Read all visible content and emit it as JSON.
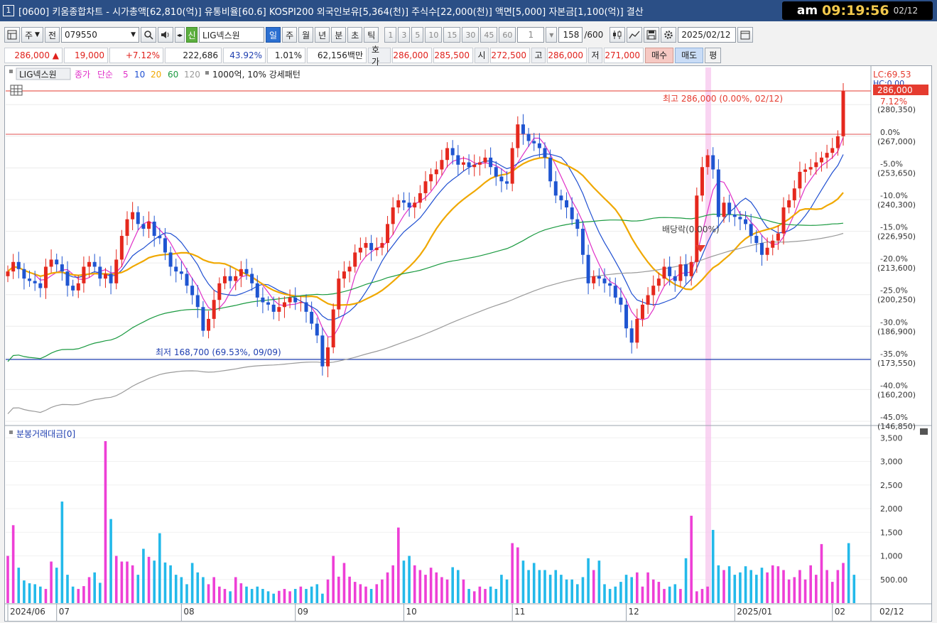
{
  "window": {
    "number": "1",
    "title": "[0600] 키움종합차트 - 시가총액[62,810(억)] 유통비율[60.6] KOSPI200 외국인보유[5,364(천)] 주식수[22,000(천)] 액면[5,000] 자본금[1,100(억)] 결산"
  },
  "clock": {
    "ampm": "am",
    "time": "09:19:56",
    "date": "02/12"
  },
  "toolbar": {
    "market": "주",
    "mode": "전",
    "code": "079550",
    "badge": "신",
    "stock_name": "LIG넥스원",
    "periods": [
      "일",
      "주",
      "월",
      "년",
      "분",
      "초",
      "틱"
    ],
    "active_period": "일",
    "minute_options": [
      "1",
      "3",
      "5",
      "10",
      "15",
      "30",
      "45",
      "60"
    ],
    "interval": "1",
    "count": "158",
    "count_max": "/600",
    "date": "2025/02/12"
  },
  "quote": {
    "price": "286,000 ▲",
    "change": "19,000",
    "change_rate": "+7.12%",
    "volume": "222,686",
    "vol_ratio": "43.92%",
    "turnover": "1.01%",
    "amount": "62,156백만",
    "hoga_label": "호가",
    "ask": "286,000",
    "bid": "285,500",
    "open_label": "시",
    "open": "272,500",
    "high_label": "고",
    "high": "286,000",
    "low_label": "저",
    "low": "271,000",
    "buy_label": "매수",
    "sell_label": "매도",
    "eval_label": "평"
  },
  "legend": {
    "name": "LIG넥스원",
    "close": "종가",
    "simple": "단순",
    "ma_labels": [
      "5",
      "10",
      "20",
      "60",
      "120"
    ],
    "ma_colors": [
      "#e030c8",
      "#1f4fd1",
      "#f0a800",
      "#1a9a40",
      "#9a9a9a"
    ],
    "extra": "1000억, 10% 강세패턴"
  },
  "annotations": {
    "high_text": "최고 286,000 (0.00%, 02/12)",
    "low_text": "최저 168,700 (69.53%, 09/09)",
    "dividend_text": "배당락(0.00%)",
    "lc_label": "LC:69.53",
    "hc_label": "HC:0.00",
    "price_tag": "286,000",
    "price_change_tag": "7.12%"
  },
  "volume_pane": {
    "title": "분봉거래대금[0]"
  },
  "axis": {
    "price_ticks": [
      {
        "pct": "",
        "price": "(280,350)"
      },
      {
        "pct": "0.0%",
        "price": "(267,000)"
      },
      {
        "pct": "-5.0%",
        "price": "(253,650)"
      },
      {
        "pct": "-10.0%",
        "price": "(240,300)"
      },
      {
        "pct": "-15.0%",
        "price": "(226,950)"
      },
      {
        "pct": "-20.0%",
        "price": "(213,600)"
      },
      {
        "pct": "-25.0%",
        "price": "(200,250)"
      },
      {
        "pct": "-30.0%",
        "price": "(186,900)"
      },
      {
        "pct": "-35.0%",
        "price": "(173,550)"
      },
      {
        "pct": "-40.0%",
        "price": "(160,200)"
      },
      {
        "pct": "-45.0%",
        "price": "(146,850)"
      }
    ],
    "volume_ticks": [
      "3,500",
      "3,000",
      "2,500",
      "2,000",
      "1,500",
      "1,000",
      "500.00"
    ],
    "date_labels": [
      "2024/06",
      "07",
      "08",
      "09",
      "10",
      "11",
      "12",
      "2025/01",
      "02",
      "02/12"
    ]
  },
  "chart_data": {
    "type": "candlestick",
    "series_price": [
      {
        "name": "종가"
      },
      {
        "name": "5"
      },
      {
        "name": "10"
      },
      {
        "name": "20"
      },
      {
        "name": "60"
      },
      {
        "name": "120"
      }
    ],
    "ylim_price": [
      146850,
      290000
    ],
    "ylim_volume": [
      0,
      3700
    ],
    "volume_unit": "억",
    "closes": [
      210000,
      214000,
      211000,
      207000,
      206000,
      205000,
      203000,
      212000,
      215000,
      213000,
      210000,
      204000,
      202000,
      205000,
      212000,
      214000,
      212000,
      207000,
      209000,
      205000,
      215000,
      225000,
      232000,
      235000,
      230000,
      228000,
      231000,
      225000,
      224000,
      218000,
      212000,
      210000,
      209000,
      204000,
      200000,
      195000,
      185000,
      190000,
      198000,
      205000,
      208000,
      206000,
      208000,
      211000,
      209000,
      205000,
      199000,
      197000,
      196000,
      193000,
      195000,
      197000,
      199000,
      197000,
      197000,
      193000,
      188000,
      183000,
      170000,
      178000,
      194000,
      207000,
      210000,
      212000,
      218000,
      220000,
      222000,
      219000,
      220000,
      222000,
      230000,
      237000,
      240000,
      239000,
      237000,
      239000,
      243000,
      248000,
      251000,
      253000,
      257000,
      262000,
      259000,
      255000,
      256000,
      254000,
      255000,
      256000,
      258000,
      254000,
      250000,
      248000,
      247000,
      262000,
      272000,
      268000,
      265000,
      264000,
      262000,
      258000,
      248000,
      242000,
      240000,
      237000,
      232000,
      228000,
      217000,
      205000,
      208000,
      207000,
      205000,
      204000,
      199000,
      196000,
      186000,
      180000,
      190000,
      196000,
      200000,
      204000,
      207000,
      212000,
      208000,
      206000,
      213000,
      208000,
      214000,
      242000,
      254000,
      259000,
      253000,
      233000,
      239000,
      234000,
      233000,
      232000,
      230000,
      225000,
      222000,
      217000,
      220000,
      223000,
      226000,
      237000,
      240000,
      245000,
      252000,
      253000,
      254000,
      256000,
      258000,
      260000,
      262000,
      267000,
      286000
    ],
    "volumes": [
      1000,
      1650,
      750,
      480,
      420,
      400,
      350,
      300,
      880,
      750,
      2150,
      600,
      350,
      300,
      360,
      550,
      650,
      430,
      3430,
      1780,
      1000,
      880,
      880,
      800,
      600,
      1150,
      980,
      900,
      1480,
      860,
      800,
      600,
      550,
      400,
      850,
      650,
      550,
      400,
      550,
      350,
      300,
      250,
      550,
      420,
      350,
      300,
      350,
      300,
      250,
      200,
      260,
      300,
      250,
      300,
      350,
      300,
      350,
      400,
      200,
      500,
      1000,
      560,
      850,
      560,
      450,
      400,
      350,
      300,
      400,
      500,
      650,
      800,
      1600,
      900,
      1000,
      800,
      700,
      600,
      750,
      650,
      550,
      500,
      760,
      700,
      500,
      300,
      250,
      350,
      300,
      350,
      300,
      600,
      500,
      1270,
      1180,
      900,
      700,
      850,
      700,
      700,
      600,
      700,
      600,
      500,
      500,
      400,
      550,
      950,
      700,
      900,
      400,
      300,
      350,
      450,
      600,
      550,
      650,
      350,
      650,
      500,
      450,
      300,
      350,
      400,
      300,
      950,
      1850,
      250,
      300,
      350,
      1550,
      800,
      700,
      780,
      600,
      650,
      780,
      700,
      600,
      750,
      650,
      800,
      780,
      700,
      500,
      550,
      700,
      500,
      800,
      600,
      1250,
      700,
      450,
      700,
      850,
      1270,
      600
    ]
  }
}
